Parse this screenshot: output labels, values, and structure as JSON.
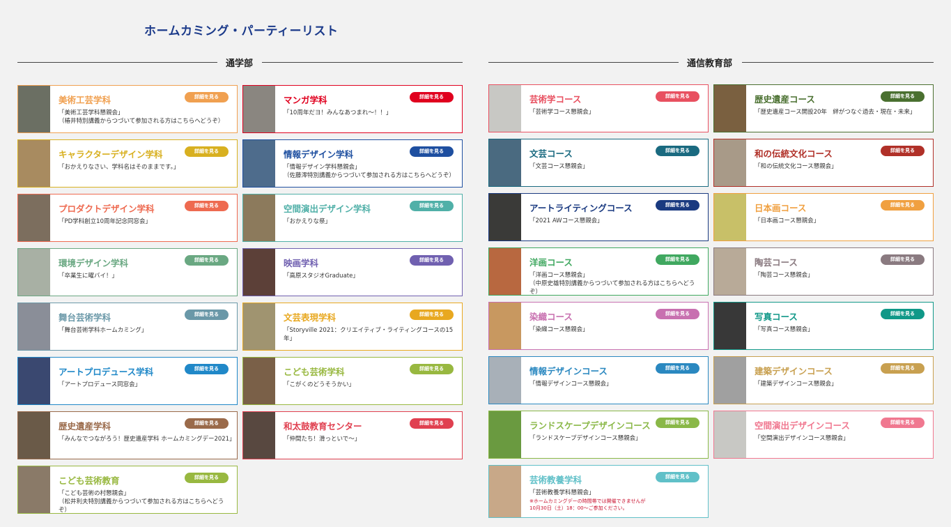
{
  "page_title": "ホームカミング・パーティーリスト",
  "detail_label": "詳細を見る",
  "sections": [
    {
      "label": "通学部",
      "cards": [
        {
          "title": "美術工芸学科",
          "desc": "「美術工芸学科懇親会」\n（椿井特別講義からつづいて参加される方はこちらへどうぞ）",
          "color": "#f0a050",
          "thumb": "#6b6f63"
        },
        {
          "title": "マンガ学科",
          "desc": "「10周年だヨ！みんなあつまれ～！！」",
          "color": "#e0001e",
          "thumb": "#8a8680"
        },
        {
          "title": "キャラクターデザイン学科",
          "desc": "「おかえりなさい、学科名はそのままです。」",
          "color": "#d8b020",
          "thumb": "#a88b60"
        },
        {
          "title": "情報デザイン学科",
          "desc": "「情報デザイン学科懇親会」\n（佐藤澪特別講義からつづいて参加される方はこちらへどうぞ）",
          "color": "#1e4fa0",
          "thumb": "#4e6c8c"
        },
        {
          "title": "プロダクトデザイン学科",
          "desc": "「PD学科創立10周年記念同窓会」",
          "color": "#ee6a50",
          "thumb": "#7c6e5e"
        },
        {
          "title": "空間演出デザイン学科",
          "desc": "「おかえりな祭」",
          "color": "#50b0a8",
          "thumb": "#8c7a5c"
        },
        {
          "title": "環境デザイン学科",
          "desc": "「卒業生に曜バイ！」",
          "color": "#6aa882",
          "thumb": "#a8b0a4"
        },
        {
          "title": "映画学科",
          "desc": "「高原スタジオGraduate」",
          "color": "#7060b0",
          "thumb": "#5c4038"
        },
        {
          "title": "舞台芸術学科",
          "desc": "「舞台芸術学科ホームカミング」",
          "color": "#6a98a8",
          "thumb": "#8a8e98"
        },
        {
          "title": "文芸表現学科",
          "desc": "「Storyville 2021：クリエイティブ・ライティングコースの15年」",
          "color": "#e8a820",
          "thumb": "#a09470"
        },
        {
          "title": "アートプロデュース学科",
          "desc": "「アートプロデュース同窓会」",
          "color": "#2088c8",
          "thumb": "#3a4870"
        },
        {
          "title": "こども芸術学科",
          "desc": "「こがくのどうそうかい」",
          "color": "#98b840",
          "thumb": "#7a6048"
        },
        {
          "title": "歴史遺産学科",
          "desc": "「みんなでつながろう！歴史遺産学科 ホームカミングデー2021」",
          "color": "#9a6a4a",
          "thumb": "#6a5a48"
        },
        {
          "title": "和太鼓教育センター",
          "desc": "「仲間たち！滑っといで～」",
          "color": "#e04050",
          "thumb": "#584840"
        },
        {
          "title": "こども芸術教育",
          "desc": "「こども芸術の村懇親会」\n（松井利夫特別講義からつづいて参加される方はこちらへどうぞ）",
          "color": "#98b840",
          "thumb": "#8a7a68"
        }
      ]
    },
    {
      "label": "通信教育部",
      "cards": [
        {
          "title": "芸術学コース",
          "desc": "「芸術学コース懇親会」",
          "color": "#e85060",
          "thumb": "#c8c8c4"
        },
        {
          "title": "歴史遺産コース",
          "desc": "「歴史遺産コース開設20年　絆がつなぐ過去・現在・未来」",
          "color": "#4a7030",
          "thumb": "#7a6040"
        },
        {
          "title": "文芸コース",
          "desc": "「文芸コース懇親会」",
          "color": "#1a6a80",
          "thumb": "#4a6a80"
        },
        {
          "title": "和の伝統文化コース",
          "desc": "「和の伝統文化コース懇親会」",
          "color": "#b03028",
          "thumb": "#a89a88"
        },
        {
          "title": "アートライティングコース",
          "desc": "「2021 AWコース懇親会」",
          "color": "#1a3a80",
          "thumb": "#3a3a38"
        },
        {
          "title": "日本画コース",
          "desc": "「日本画コース懇親会」",
          "color": "#f0a040",
          "thumb": "#c8c068"
        },
        {
          "title": "洋画コース",
          "desc": "「洋画コース懇親会」\n（中原史雄特別講義からつづいて参加される方はこちらへどうぞ）",
          "color": "#40a860",
          "thumb": "#b86840"
        },
        {
          "title": "陶芸コース",
          "desc": "「陶芸コース懇親会」",
          "color": "#8a7a80",
          "thumb": "#b8aa98"
        },
        {
          "title": "染織コース",
          "desc": "「染織コース懇親会」",
          "color": "#c870b0",
          "thumb": "#c89860"
        },
        {
          "title": "写真コース",
          "desc": "「写真コース懇親会」",
          "color": "#109888",
          "thumb": "#383838"
        },
        {
          "title": "情報デザインコース",
          "desc": "「情報デザインコース懇親会」",
          "color": "#2a88c0",
          "thumb": "#a8b0b8"
        },
        {
          "title": "建築デザインコース",
          "desc": "「建築デザインコース懇親会」",
          "color": "#c8a050",
          "thumb": "#a0a0a0"
        },
        {
          "title": "ランドスケープデザインコース",
          "desc": "「ランドスケープデザインコース懇親会」",
          "color": "#8ab848",
          "thumb": "#6a9a40"
        },
        {
          "title": "空間演出デザインコース",
          "desc": "「空間演出デザインコース懇親会」",
          "color": "#f07890",
          "thumb": "#c8c8c4"
        },
        {
          "title": "芸術教養学科",
          "desc": "「芸術教養学科懇親会」",
          "note": "※ホームカミングデーの時間帯では開催できませんが\n10月30日（土）18：00～ご参加ください。",
          "color": "#60c0c8",
          "thumb": "#c8a888"
        }
      ]
    }
  ]
}
